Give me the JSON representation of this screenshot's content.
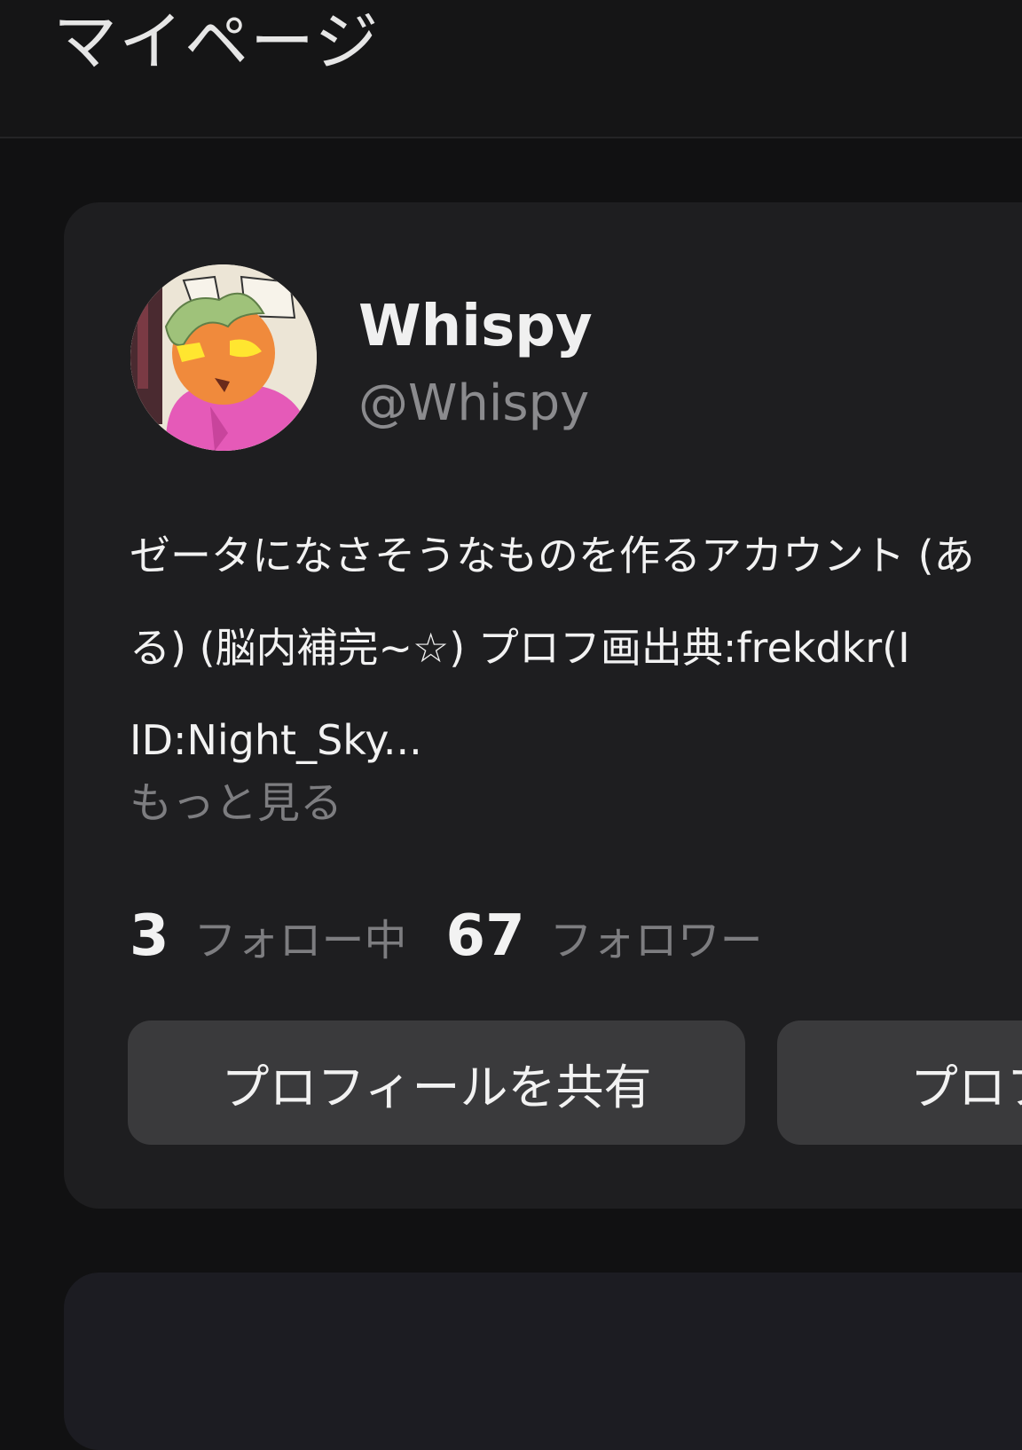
{
  "header": {
    "title": "マイページ"
  },
  "profile": {
    "display_name": "Whispy",
    "handle": "@Whispy",
    "avatar_icon": "profile-avatar-image",
    "bio_lines": [
      "ゼータになさそうなものを作るアカウント (あ",
      "る) (脳内補完~☆) プロフ画出典:frekdkr(I",
      "ID:Night_Sky..."
    ],
    "more_label": "もっと見る"
  },
  "stats": {
    "following_count": "3",
    "following_label": "フォロー中",
    "followers_count": "67",
    "followers_label": "フォロワー"
  },
  "buttons": {
    "share_label": "プロフィールを共有",
    "edit_label": "プロフ"
  }
}
